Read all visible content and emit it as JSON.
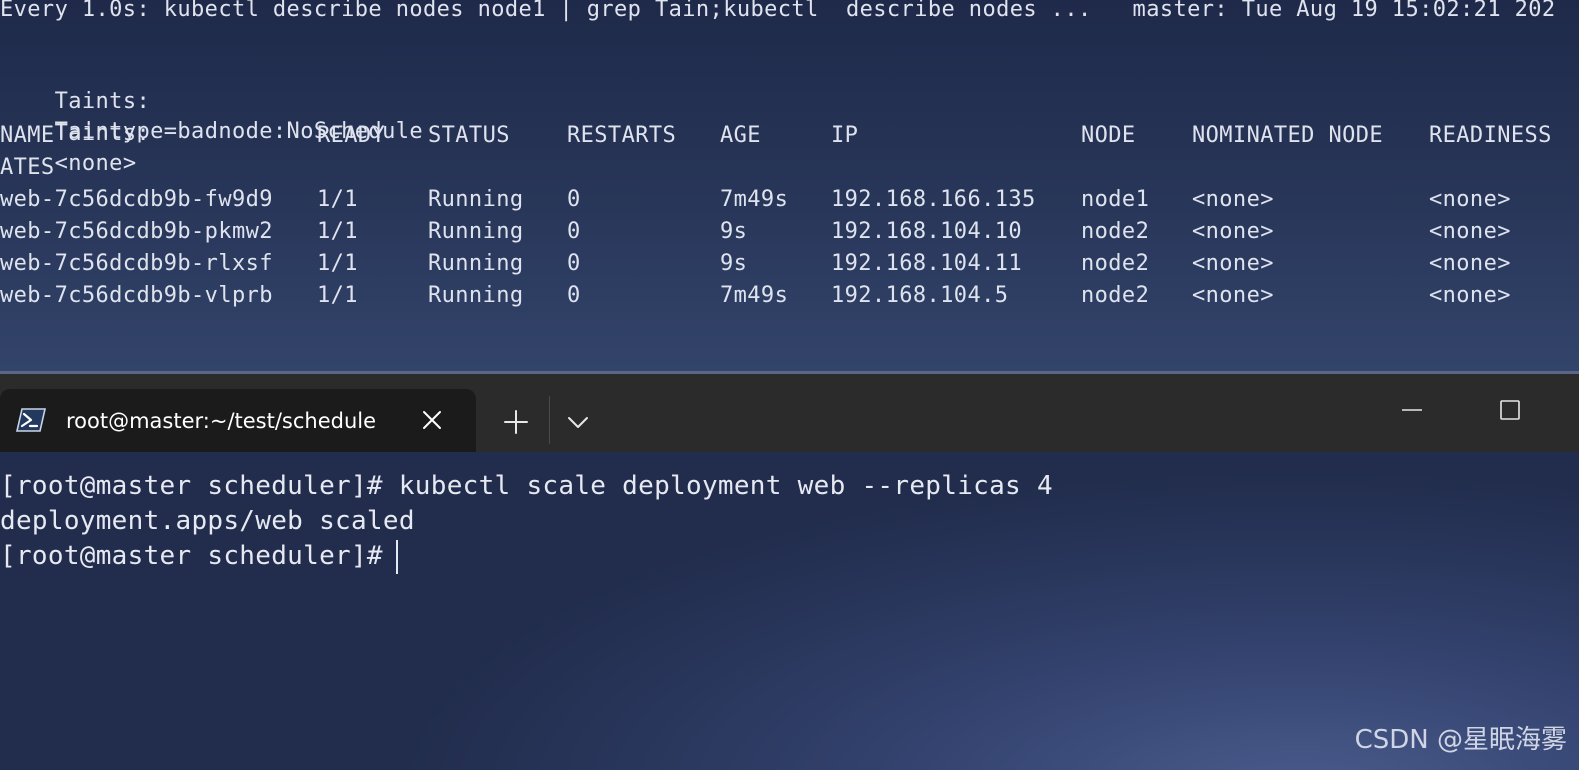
{
  "top_pane": {
    "watch_header": "Every 1.0s: kubectl describe nodes node1 | grep Tain;kubectl  describe nodes ...   master: Tue Aug 19 15:02:21 202",
    "taint_lines": [
      {
        "label": "Taints:",
        "value": "Taintype=badnode:NoSchedule"
      },
      {
        "label": "Taints:",
        "value": "<none>"
      }
    ],
    "pods_table": {
      "columns": [
        "NAME",
        "READY",
        "STATUS",
        "RESTARTS",
        "AGE",
        "IP",
        "NODE",
        "NOMINATED NODE",
        "READINESS"
      ],
      "wrapped_header": "ATES",
      "rows": [
        [
          "web-7c56dcdb9b-fw9d9",
          "1/1",
          "Running",
          "0",
          "7m49s",
          "192.168.166.135",
          "node1",
          "<none>",
          "<none>"
        ],
        [
          "web-7c56dcdb9b-pkmw2",
          "1/1",
          "Running",
          "0",
          "9s",
          "192.168.104.10",
          "node2",
          "<none>",
          "<none>"
        ],
        [
          "web-7c56dcdb9b-rlxsf",
          "1/1",
          "Running",
          "0",
          "9s",
          "192.168.104.11",
          "node2",
          "<none>",
          "<none>"
        ],
        [
          "web-7c56dcdb9b-vlprb",
          "1/1",
          "Running",
          "0",
          "7m49s",
          "192.168.104.5",
          "node2",
          "<none>",
          "<none>"
        ]
      ]
    }
  },
  "tabbar": {
    "tab_title": "root@master:~/test/schedule",
    "icons": {
      "tab": "powershell-icon",
      "close": "close-icon",
      "new_tab": "plus-icon",
      "dropdown": "chevron-down-icon",
      "minimize": "minimize-icon",
      "maximize": "maximize-icon"
    }
  },
  "bottom_pane": {
    "lines": [
      "[root@master scheduler]# kubectl scale deployment web --replicas 4",
      "deployment.apps/web scaled",
      "[root@master scheduler]# "
    ]
  },
  "watermark": "CSDN @星眠海雾",
  "colors": {
    "terminal_text": "#dfe3ee",
    "tabbar_bg": "#2b2b2b",
    "active_tab_bg": "#1b1b1b"
  }
}
